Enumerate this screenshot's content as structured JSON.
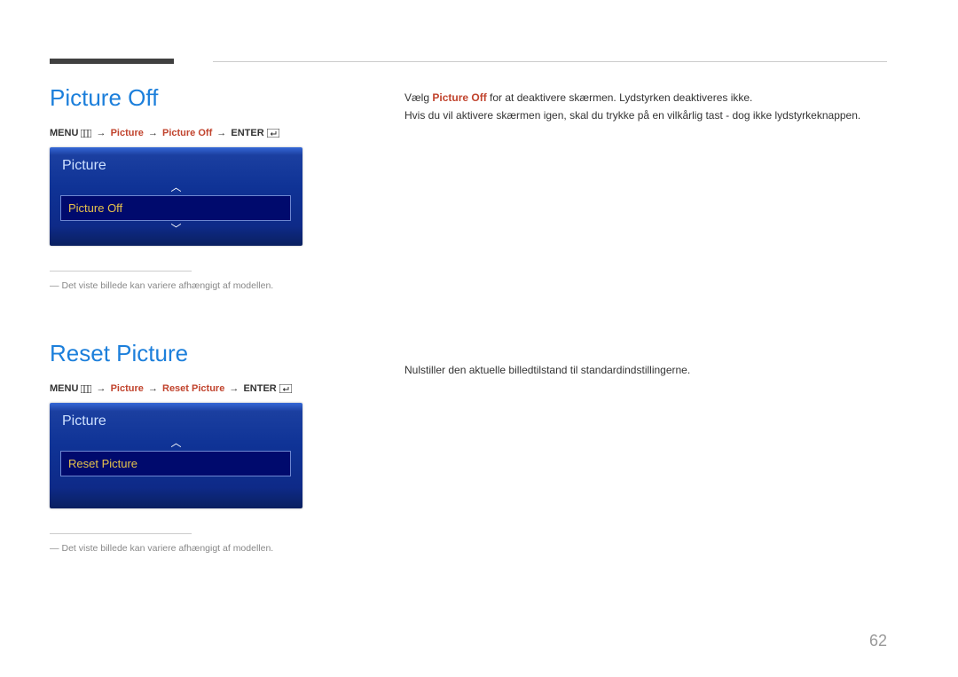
{
  "page_number": "62",
  "section1": {
    "heading": "Picture Off",
    "breadcrumb": {
      "menu": "MENU",
      "p1": "Picture",
      "p2": "Picture Off",
      "enter": "ENTER"
    },
    "osd": {
      "title": "Picture",
      "selected": "Picture Off"
    },
    "footnote": "Det viste billede kan variere afhængigt af modellen.",
    "desc_prefix": "Vælg ",
    "desc_highlight": "Picture Off",
    "desc_suffix": " for at deaktivere skærmen. Lydstyrken deaktiveres ikke.",
    "desc_line2": "Hvis du vil aktivere skærmen igen, skal du trykke på en vilkårlig tast - dog ikke lydstyrkeknappen."
  },
  "section2": {
    "heading": "Reset Picture",
    "breadcrumb": {
      "menu": "MENU",
      "p1": "Picture",
      "p2": "Reset Picture",
      "enter": "ENTER"
    },
    "osd": {
      "title": "Picture",
      "selected": "Reset Picture"
    },
    "footnote": "Det viste billede kan variere afhængigt af modellen.",
    "desc": "Nulstiller den aktuelle billedtilstand til standardindstillingerne."
  }
}
